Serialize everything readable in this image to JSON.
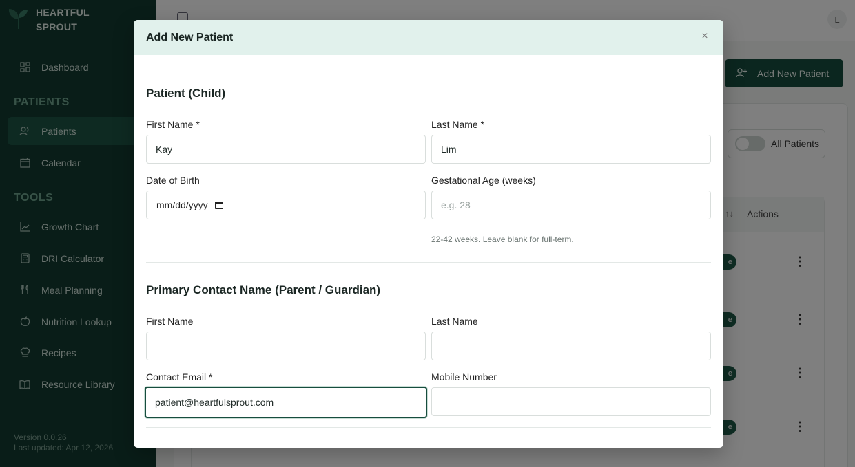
{
  "brand": {
    "line1": "HEARTFUL",
    "line2": "SPROUT"
  },
  "sidebar": {
    "dashboard": "Dashboard",
    "patients_section": "PATIENTS",
    "patients": "Patients",
    "calendar": "Calendar",
    "tools_section": "TOOLS",
    "growth_chart": "Growth Chart",
    "dri_calculator": "DRI Calculator",
    "meal_planning": "Meal Planning",
    "nutrition_lookup": "Nutrition Lookup",
    "recipes": "Recipes",
    "resource_library": "Resource Library",
    "version": "Version 0.0.26",
    "last_updated": "Last updated: Apr 12, 2026"
  },
  "topbar": {
    "avatar_initial": "L"
  },
  "page": {
    "add_button_label": "Add New Patient",
    "toggle_label": "All Patients",
    "actions_header": "Actions",
    "sort_glyph": "↑↓"
  },
  "modal": {
    "title": "Add New Patient",
    "close_glyph": "×",
    "child_section": "Patient (Child)",
    "child_first_name_label": "First Name *",
    "child_first_name_value": "Kay",
    "child_last_name_label": "Last Name *",
    "child_last_name_value": "Lim",
    "dob_label": "Date of Birth",
    "dob_placeholder": "mm/dd/yyyy",
    "gest_label": "Gestational Age (weeks)",
    "gest_placeholder": "e.g. 28",
    "gest_helper": "22-42 weeks. Leave blank for full-term.",
    "contact_section": "Primary Contact Name (Parent / Guardian)",
    "contact_first_name_label": "First Name",
    "contact_first_name_value": "",
    "contact_last_name_label": "Last Name",
    "contact_last_name_value": "",
    "email_label": "Contact Email *",
    "email_value": "patient@heartfulsprout.com",
    "mobile_label": "Mobile Number",
    "mobile_value": ""
  },
  "colors": {
    "sidebar_bg": "#123a30",
    "accent": "#174d3e",
    "modal_header_bg": "#e1f1ec"
  },
  "icons": {
    "dashboard": "grid-icon",
    "patients": "users-icon",
    "calendar": "calendar-icon",
    "growth_chart": "line-chart-icon",
    "dri_calculator": "calculator-icon",
    "meal_planning": "utensils-icon",
    "nutrition_lookup": "apple-icon",
    "recipes": "chef-hat-icon",
    "resource_library": "book-icon"
  }
}
